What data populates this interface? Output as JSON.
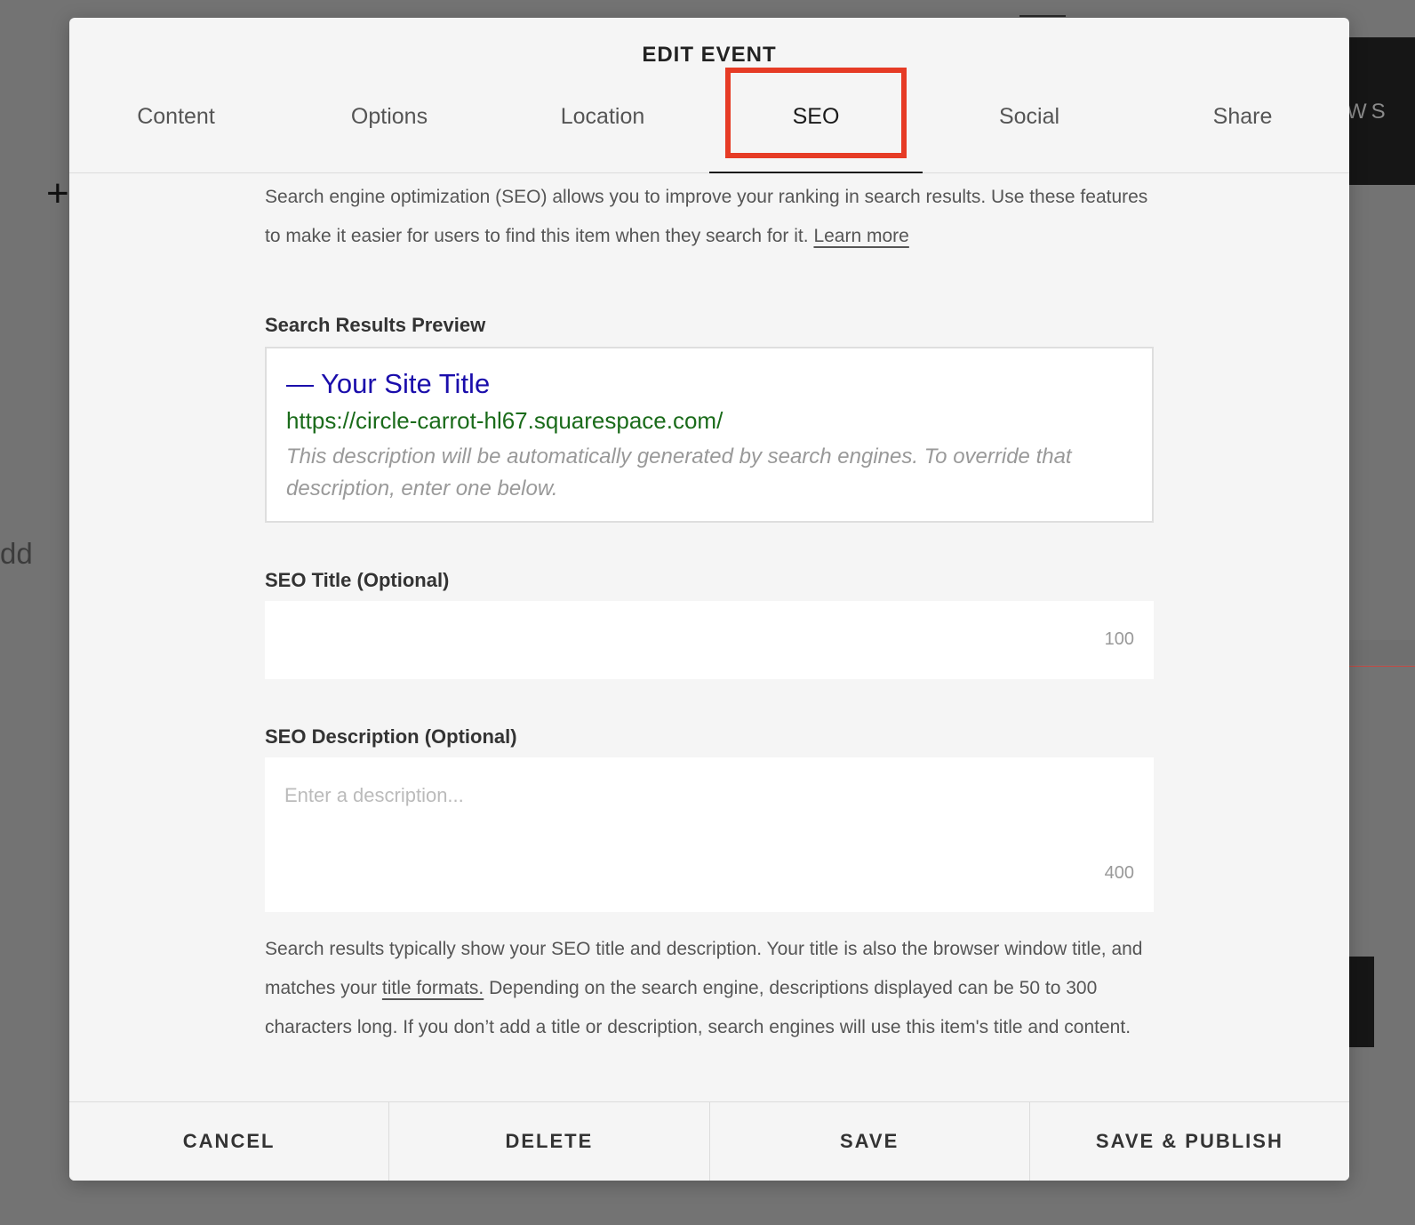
{
  "background": {
    "side_text": "WS",
    "plus_glyph": "+",
    "side_label": "dd"
  },
  "dialog": {
    "title": "EDIT EVENT",
    "tabs": [
      {
        "label": "Content",
        "active": false
      },
      {
        "label": "Options",
        "active": false
      },
      {
        "label": "Location",
        "active": false
      },
      {
        "label": "SEO",
        "active": true
      },
      {
        "label": "Social",
        "active": false
      },
      {
        "label": "Share",
        "active": false
      }
    ],
    "highlight_color": "#e63b25"
  },
  "seo": {
    "intro": "Search engine optimization (SEO) allows you to improve your ranking in search results. Use these features to make it easier for users to find this item when they search for it.",
    "learn_more": "Learn more",
    "preview_label": "Search Results Preview",
    "preview": {
      "title": "— Your Site Title",
      "url": "https://circle-carrot-hl67.squarespace.com/",
      "description": "This description will be automatically generated by search engines. To override that description, enter one below."
    },
    "title_label": "SEO Title (Optional)",
    "title_value": "",
    "title_counter": "100",
    "description_label": "SEO Description (Optional)",
    "description_placeholder": "Enter a description...",
    "description_counter": "400",
    "footnote_part1": "Search results typically show your SEO title and description. Your title is also the browser window title, and matches your",
    "footnote_link": "title formats.",
    "footnote_part2": "Depending on the search engine, descriptions displayed can be 50 to 300 characters long. If you don’t add a title or description, search engines will use this item's title and content."
  },
  "footer": {
    "cancel": "CANCEL",
    "delete": "DELETE",
    "save": "SAVE",
    "save_publish": "SAVE & PUBLISH"
  },
  "colors": {
    "preview_title": "#1a0dab",
    "preview_url": "#1a6b1a"
  }
}
